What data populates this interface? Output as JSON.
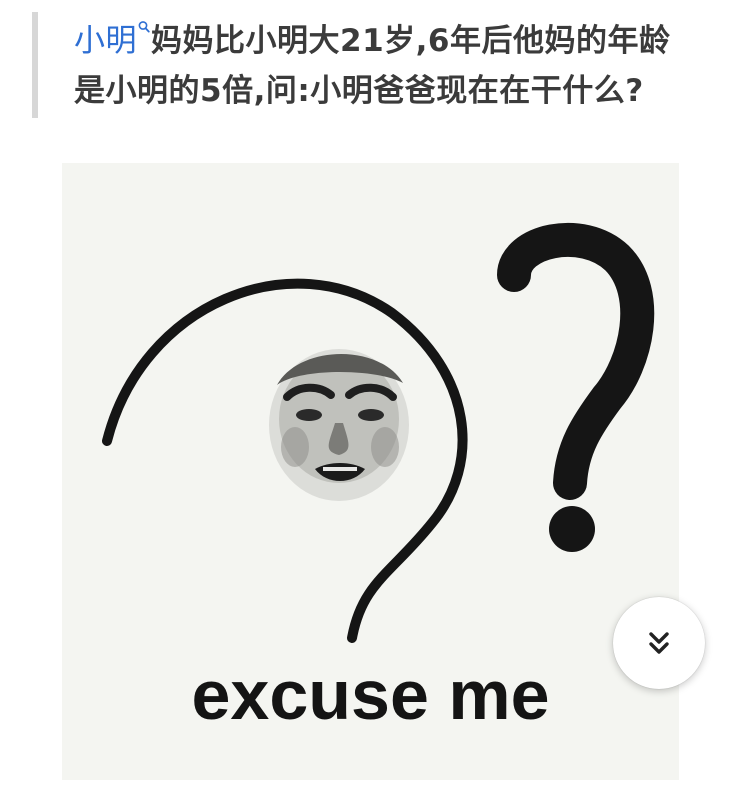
{
  "post": {
    "linked_term": "小明",
    "question_line_1": "妈妈比小明大21岁,6年后他妈的年龄",
    "question_line_2": "是小明的5倍,问:小明爸爸现在在干什么?"
  },
  "meme": {
    "caption": "excuse me",
    "background_color": "#f4f5f1"
  },
  "scroll_button": {
    "icon": "double-chevron-down-icon"
  },
  "colors": {
    "link": "#2f6fd3",
    "text": "#3b3b3b",
    "quote_bar": "#d7d7d7"
  }
}
